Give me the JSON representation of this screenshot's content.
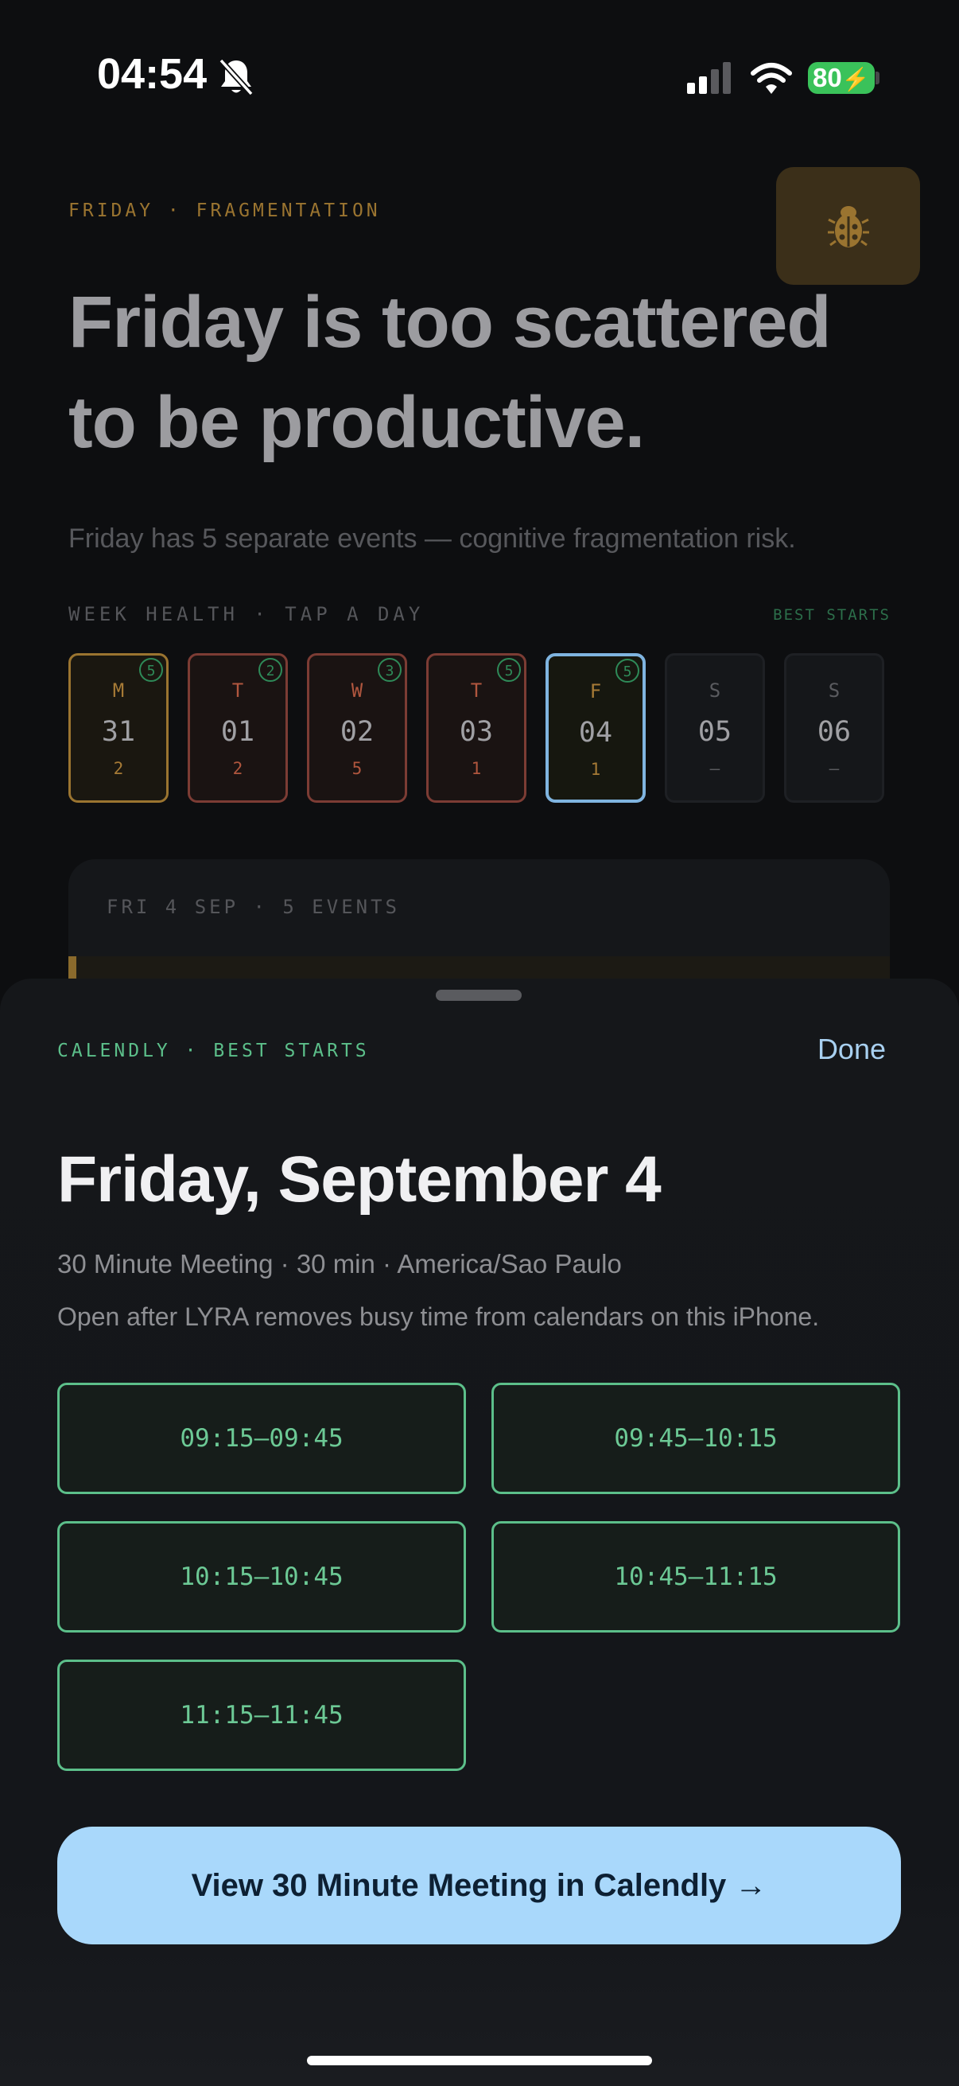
{
  "status_bar": {
    "time": "04:54",
    "battery": "80",
    "icons": [
      "bell-slash-icon",
      "cellular-signal-icon",
      "wifi-icon",
      "battery-charging-icon"
    ]
  },
  "background": {
    "overline": "FRIDAY · FRAGMENTATION",
    "bug_icon": "bug-icon",
    "headline": "Friday is too scattered to be productive.",
    "subtext": "Friday has 5 separate events — cognitive fragmentation risk.",
    "week_label": "WEEK HEALTH · TAP A DAY",
    "best_starts_link": "BEST STARTS",
    "days": [
      {
        "letter": "M",
        "date": "31",
        "count": "2",
        "badge": "5",
        "status": "warning"
      },
      {
        "letter": "T",
        "date": "01",
        "count": "2",
        "badge": "2",
        "status": "bad"
      },
      {
        "letter": "W",
        "date": "02",
        "count": "5",
        "badge": "3",
        "status": "bad"
      },
      {
        "letter": "T",
        "date": "03",
        "count": "1",
        "badge": "5",
        "status": "bad"
      },
      {
        "letter": "F",
        "date": "04",
        "count": "1",
        "badge": "5",
        "status": "selected"
      },
      {
        "letter": "S",
        "date": "05",
        "count": "—",
        "badge": "",
        "status": "empty"
      },
      {
        "letter": "S",
        "date": "06",
        "count": "—",
        "badge": "",
        "status": "empty"
      }
    ],
    "day_card_label": "FRI 4 SEP · 5 EVENTS"
  },
  "sheet": {
    "label": "CALENDLY · BEST STARTS",
    "done": "Done",
    "title": "Friday, September 4",
    "meta": "30 Minute Meeting · 30 min · America/Sao Paulo",
    "note": "Open after LYRA removes busy time from calendars on this iPhone.",
    "slots": [
      "09:15–09:45",
      "09:45–10:15",
      "10:15–10:45",
      "10:45–11:15",
      "11:15–11:45"
    ],
    "cta": "View 30 Minute Meeting in Calendly →"
  },
  "colors": {
    "background": "#0d0e10",
    "sheet": "#15171a",
    "accent_amber": "#9a7430",
    "accent_red": "#8a3f38",
    "accent_green": "#5cbf8a",
    "accent_blue": "#a9d8fb",
    "selected_border": "#7fb4e0"
  }
}
